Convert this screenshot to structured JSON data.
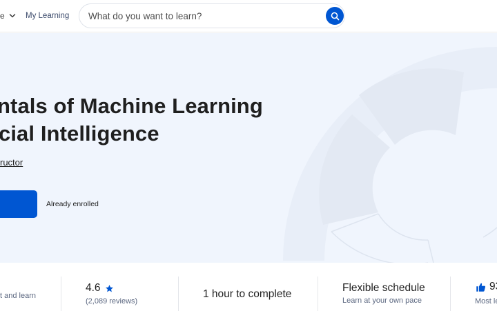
{
  "header": {
    "explore_fragment": "e",
    "my_learning": "My Learning",
    "search": {
      "placeholder": "What do you want to learn?"
    }
  },
  "hero": {
    "title_line1": "ntals of Machine Learning",
    "title_line2": "cial Intelligence",
    "instructor_fragment": "ructor",
    "enroll_button_label": "",
    "enrolled_text": "Already enrolled"
  },
  "stats": {
    "col1_text": "t and learn",
    "rating_value": "4.6",
    "rating_reviews": "(2,089 reviews)",
    "duration": "1 hour to complete",
    "schedule_title": "Flexible schedule",
    "schedule_sub": "Learn at your own pace",
    "liked_value": "93",
    "liked_sub": "Most le"
  },
  "colors": {
    "brand_blue": "#0056d2",
    "hero_bg": "#f0f5fd",
    "star_blue": "#0056d2"
  },
  "icons": {
    "search": "search-icon",
    "chevron": "chevron-down-icon",
    "star": "star-icon",
    "thumb": "thumbs-up-icon"
  }
}
